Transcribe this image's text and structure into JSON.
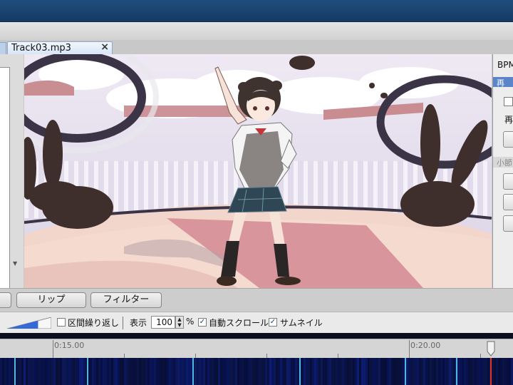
{
  "document": {
    "tab_title": "Track03.mp3",
    "tab_close": "×"
  },
  "right_panel": {
    "bpm_label": "BPM",
    "playback_header": "再​",
    "playback_label": "再",
    "bar_header": "小節"
  },
  "controls": {
    "rip_button": "リップ",
    "filter_button": "フィルター",
    "loop_label": "区間繰り返し",
    "display_label": "表示",
    "zoom_value": "100",
    "zoom_unit": "%",
    "auto_scroll_label": "自動スクロール",
    "thumbnail_label": "サムネイル",
    "loop_checked": false,
    "auto_scroll_checked": true,
    "thumbnail_checked": true,
    "volume_level": 0.7
  },
  "timeline": {
    "time_marks": [
      "0:15.00",
      "0:20.00"
    ],
    "playhead_time": "0:20.75"
  },
  "colors": {
    "accent": "#5b84c9",
    "titlebar": "#1a4472",
    "waveform": "#0a0f1e",
    "playhead": "#e0322c"
  }
}
